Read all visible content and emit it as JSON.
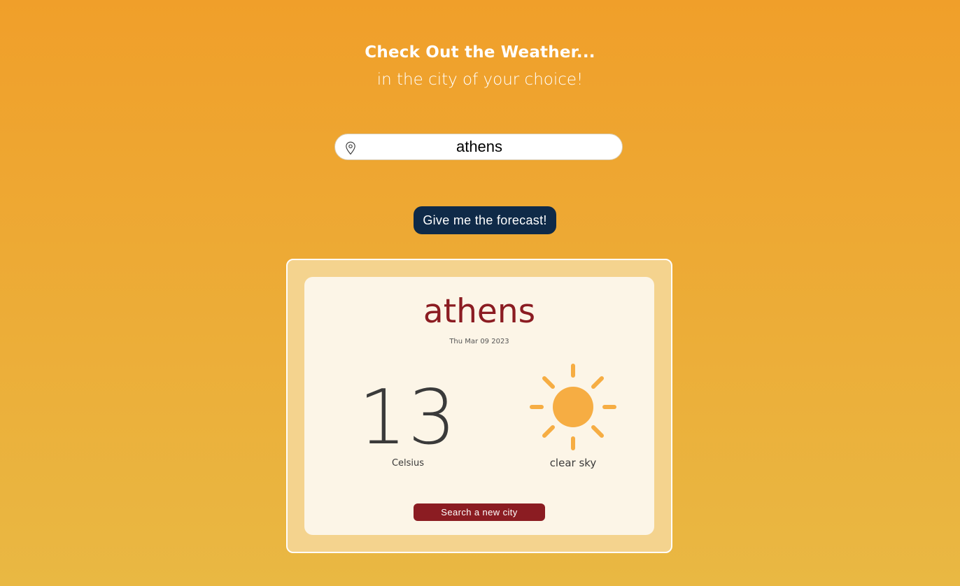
{
  "header": {
    "title": "Check Out the Weather...",
    "subtitle": "in the city of your choice!"
  },
  "search": {
    "value": "athens",
    "icon": "map-pin-icon"
  },
  "actions": {
    "forecast_label": "Give me the forecast!",
    "new_city_label": "Search a new city"
  },
  "weather": {
    "city": "athens",
    "date": "Thu Mar 09 2023",
    "temperature": "13",
    "unit": "Celsius",
    "description": "clear sky",
    "icon": "sun-icon"
  },
  "colors": {
    "background_top": "#f09f2a",
    "background_bottom": "#e9b843",
    "primary_button": "#0f2a48",
    "accent": "#8b1c22",
    "card_outer": "#f4d38e",
    "card_inner": "#fcf5e7",
    "sun": "#f6ad43"
  }
}
